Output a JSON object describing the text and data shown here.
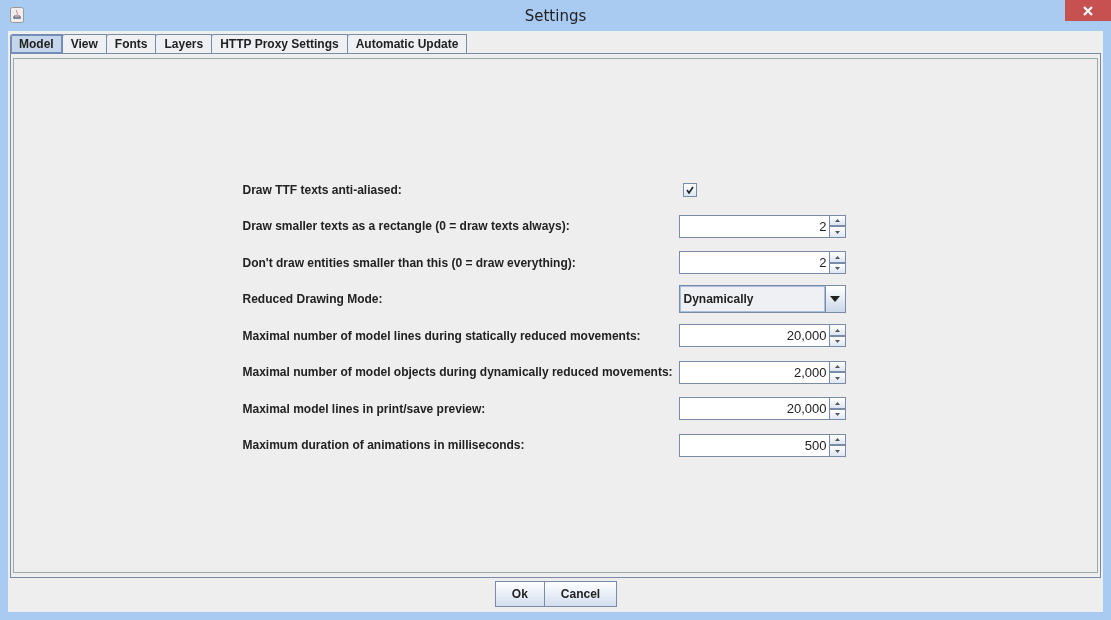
{
  "window": {
    "title": "Settings"
  },
  "tabs": [
    {
      "label": "Model",
      "selected": true
    },
    {
      "label": "View",
      "selected": false
    },
    {
      "label": "Fonts",
      "selected": false
    },
    {
      "label": "Layers",
      "selected": false
    },
    {
      "label": "HTTP Proxy Settings",
      "selected": false
    },
    {
      "label": "Automatic Update",
      "selected": false
    }
  ],
  "settings": [
    {
      "kind": "checkbox",
      "label": "Draw TTF texts anti-aliased:",
      "checked": true
    },
    {
      "kind": "spinner",
      "label": "Draw smaller texts as a rectangle (0 = draw texts always):",
      "value": "2"
    },
    {
      "kind": "spinner",
      "label": "Don't draw entities smaller than this (0 = draw everything):",
      "value": "2"
    },
    {
      "kind": "select",
      "label": "Reduced Drawing Mode:",
      "value": "Dynamically"
    },
    {
      "kind": "spinner",
      "label": "Maximal number of model lines during statically reduced movements:",
      "value": "20,000"
    },
    {
      "kind": "spinner",
      "label": "Maximal number of model objects during dynamically reduced movements:",
      "value": "2,000"
    },
    {
      "kind": "spinner",
      "label": "Maximal model lines in print/save preview:",
      "value": "20,000"
    },
    {
      "kind": "spinner",
      "label": "Maximum duration of animations in milliseconds:",
      "value": "500"
    }
  ],
  "buttons": [
    "Ok",
    "Cancel"
  ]
}
